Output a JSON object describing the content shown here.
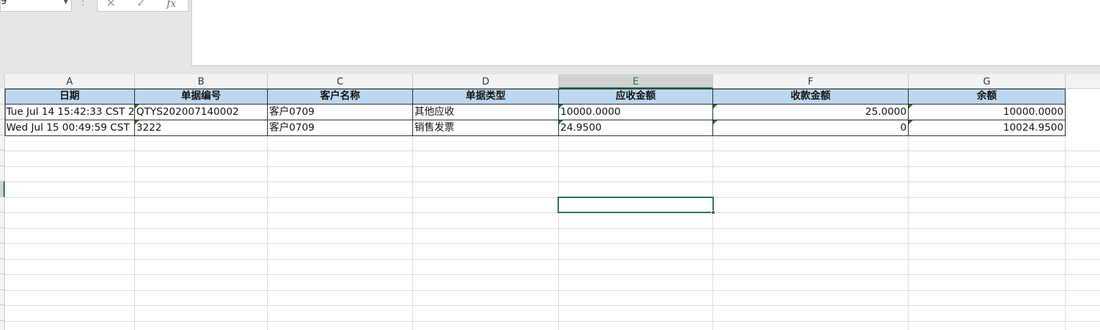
{
  "name_box": {
    "value": "9",
    "dropdown_icon": "chevron-down-icon"
  },
  "formula_bar": {
    "separator": ":",
    "cancel_icon": "close-icon",
    "enter_icon": "check-icon",
    "function_label": "fx",
    "value": ""
  },
  "sheet": {
    "columns": [
      "A",
      "B",
      "C",
      "D",
      "E",
      "F",
      "G"
    ],
    "selected_column": "E",
    "header_row": [
      "日期",
      "单据编号",
      "客户名称",
      "单据类型",
      "应收金额",
      "收款金额",
      "余额"
    ],
    "rows": [
      [
        "Tue Jul 14 15:42:33 CST 2",
        "QTYS202007140002",
        "客户0709",
        "其他应收",
        "10000.0000",
        "25.0000",
        "10000.0000"
      ],
      [
        "Wed Jul 15 00:49:59 CST",
        "3222",
        "客户0709",
        "销售发票",
        "24.9500",
        "0",
        "10024.9500"
      ]
    ]
  },
  "colors": {
    "header_fill": "#bdd7ee",
    "accent": "#217346",
    "error_indicator": "#1e7b34"
  }
}
